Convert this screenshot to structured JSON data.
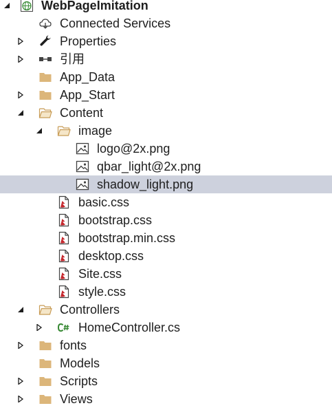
{
  "project": {
    "name": "WebPageImitation"
  },
  "tree": {
    "connected_services": "Connected Services",
    "properties": "Properties",
    "references": "引用",
    "app_data": "App_Data",
    "app_start": "App_Start",
    "content": "Content",
    "image": "image",
    "logo": "logo@2x.png",
    "qbar": "qbar_light@2x.png",
    "shadow": "shadow_light.png",
    "basic_css": "basic.css",
    "bootstrap_css": "bootstrap.css",
    "bootstrap_min_css": "bootstrap.min.css",
    "desktop_css": "desktop.css",
    "site_css": "Site.css",
    "style_css": "style.css",
    "controllers": "Controllers",
    "home_controller": "HomeController.cs",
    "fonts": "fonts",
    "models": "Models",
    "scripts": "Scripts",
    "views": "Views"
  },
  "colors": {
    "selection": "#cdd1dd",
    "folder": "#dcb67a",
    "css_file": "#c5262c",
    "csharp": "#368832",
    "web_globe": "#388a34"
  }
}
